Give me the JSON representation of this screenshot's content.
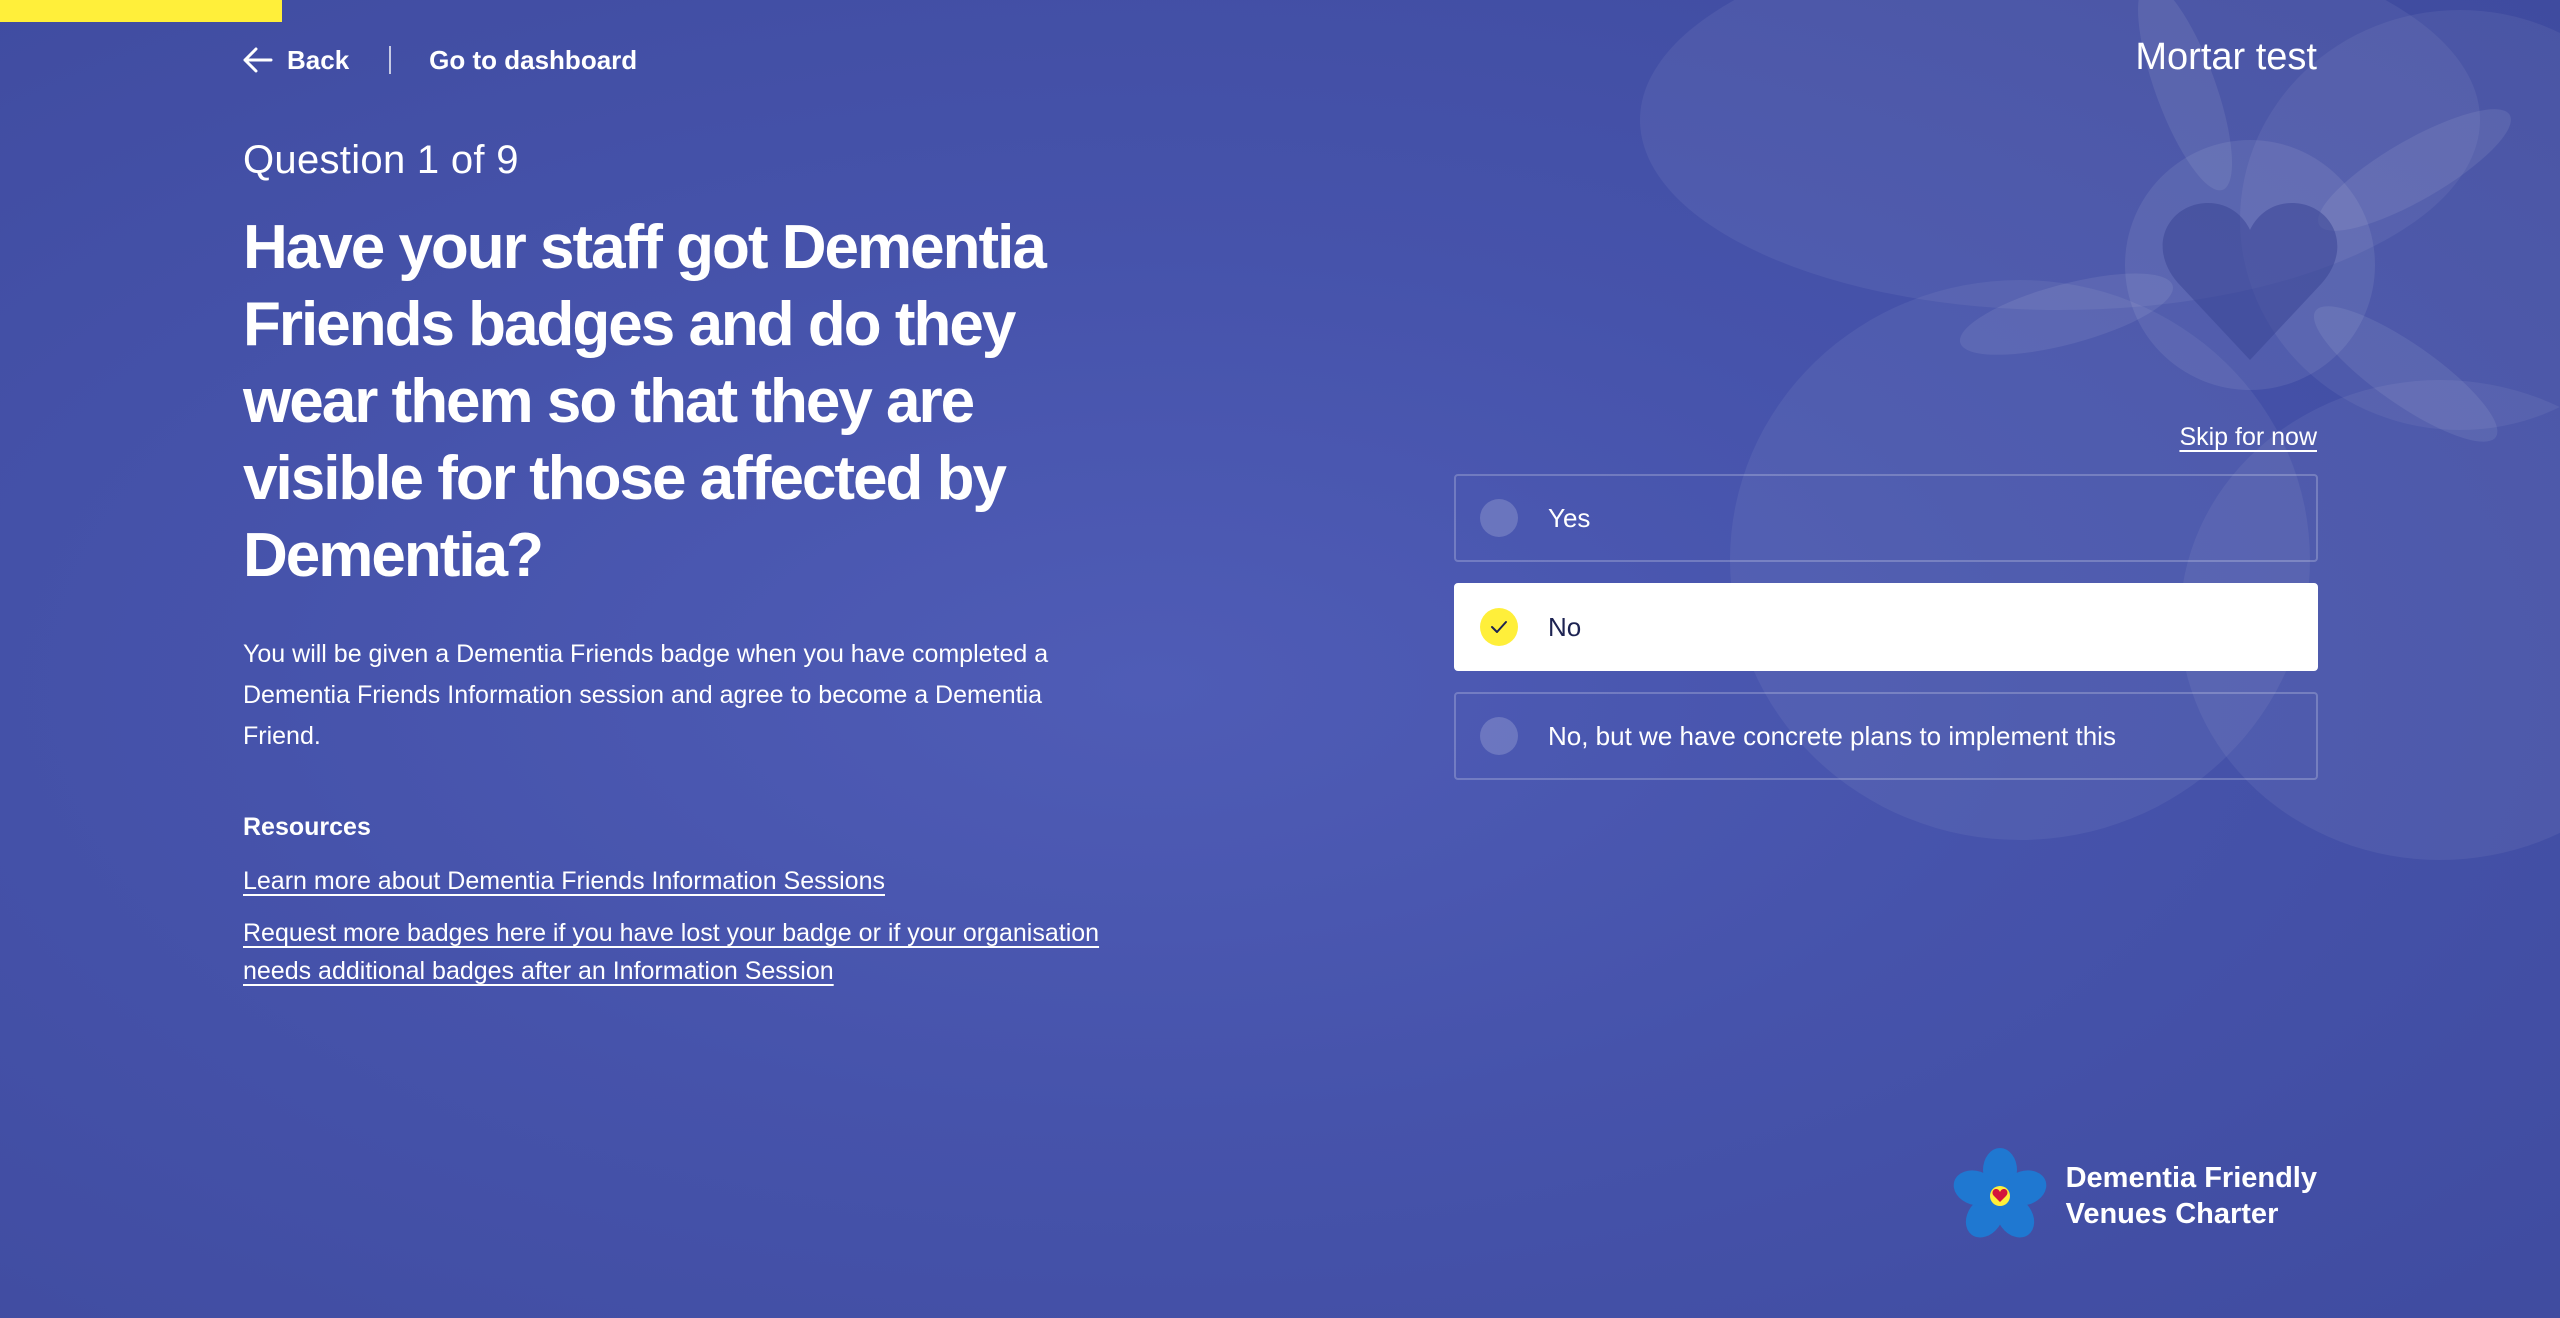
{
  "progress": {
    "fraction": 0.067,
    "color": "#ffef3a"
  },
  "nav": {
    "back_label": "Back",
    "dashboard_label": "Go to dashboard"
  },
  "venue": {
    "name": "Mortar test"
  },
  "question": {
    "counter": "Question 1 of 9",
    "title": "Have your staff got Dementia Friends badges and do they wear them so that they are visible for those affected by Dementia?",
    "description": "You will be given a Dementia Friends badge when you have completed a Dementia Friends Information session and agree to become a Dementia Friend."
  },
  "resources": {
    "title": "Resources",
    "links": [
      "Learn more about Dementia Friends Information Sessions",
      "Request more badges here if you have lost your badge or if your organisation needs additional badges after an Information Session"
    ]
  },
  "answers": {
    "skip_label": "Skip for now",
    "options": [
      "Yes",
      "No",
      "No, but we have concrete plans to implement this"
    ],
    "selected": "No"
  },
  "logo": {
    "line1": "Dementia Friendly",
    "line2": "Venues Charter"
  },
  "icons": {
    "back": "arrow-left-icon",
    "check": "check-icon",
    "logo": "forget-me-not-flower-icon"
  },
  "colors": {
    "background": "#4653ab",
    "accent": "#ffef3a",
    "logo_petal": "#1f78d1",
    "logo_heart": "#d4143c"
  }
}
